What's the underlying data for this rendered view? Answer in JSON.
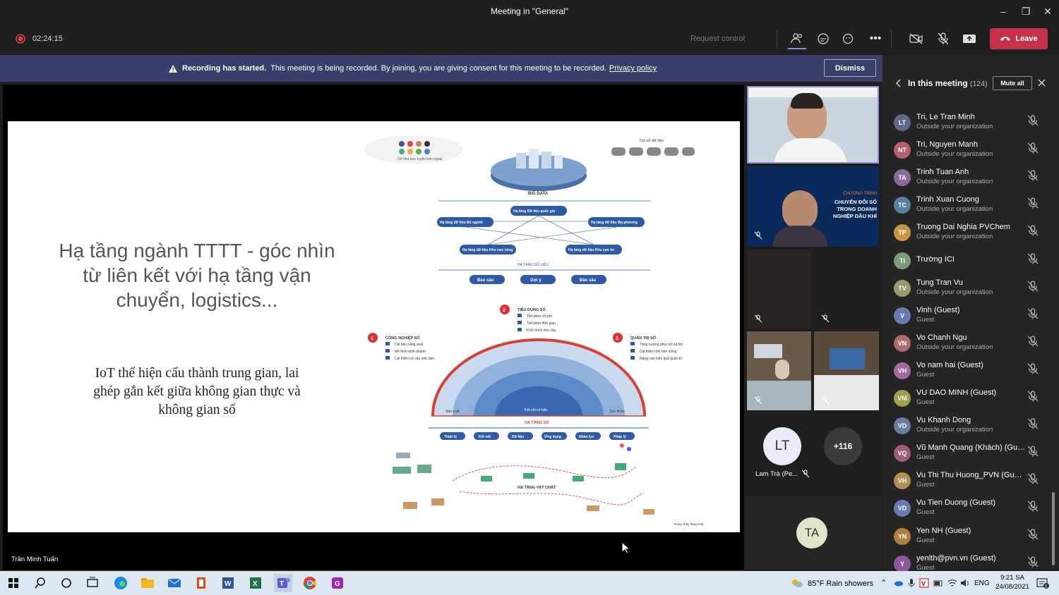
{
  "window": {
    "title": "Meeting in \"General\""
  },
  "toolbar": {
    "timer": "02:24:15",
    "request_control": "Request control",
    "leave_label": "Leave"
  },
  "banner": {
    "strong": "Recording has started.",
    "text": "This meeting is being recorded. By joining, you are giving consent for this meeting to be recorded.",
    "link": "Privacy policy",
    "dismiss": "Dismiss"
  },
  "slide": {
    "title": "Hạ tầng ngành TTTT - góc nhìn từ liên kết với hạ tầng vận chuyển, logistics...",
    "body": "IoT thể hiện cấu thành trung gian, lai ghép gắn kết giữa không gian thực và không gian số",
    "diagram": {
      "big_data": "BIG DATA",
      "source_left": "Dữ liệu trực tuyến bên ngoài",
      "source_right": "Cơ sở dữ liệu",
      "node_national": "Hạ tầng Dữ liệu quốc gia",
      "node_sector": "Hạ tầng dữ liệu Bộ ngành",
      "node_local": "Hạ tầng dữ liệu địa phương",
      "node_public": "Hạ tầng dữ liệu Khu vực công",
      "node_private": "Hạ tầng dữ liệu Khu vực tư",
      "data_layer": "HẠ TẦNG DỮ LIỆU",
      "btn1": "Báo cáo",
      "btn2": "Gợi ý",
      "btn3": "Đào sâu",
      "consumer_title": "TIÊU DÙNG SỐ",
      "consumer_items": [
        "Tiết kiệm chi phí",
        "Tiết kiệm thời gian",
        "Kích thích nhu cầu"
      ],
      "industry_title": "CÔNG NGHIỆP SỐ",
      "industry_items": [
        "Cải tiến năng suất",
        "Mô hình kinh doanh",
        "Cải thiện cơ cấu việc làm"
      ],
      "gov_title": "QUẢN TRỊ SỐ",
      "gov_items": [
        "Tăng cường phúc lợi xã hội",
        "Cải thiện tính bền vững",
        "Nâng cao hiệu quả quản trị"
      ],
      "arc_left": "Sản xuất",
      "arc_right": "Sức khỏe",
      "arc_inner": "Kết nối cơ bản",
      "infra_layer": "HẠ TẦNG SỐ",
      "chips": [
        "Thiết bị",
        "Kết nối",
        "Dữ liệu",
        "Ứng dụng",
        "Nhân lực",
        "Pháp lý"
      ],
      "physical": "HẠ TẦNG VẬT CHẤT",
      "flow_legend": "Dòng chảy hàng hóa"
    },
    "presenter": "Trần Minh Tuấn"
  },
  "tiles": {
    "lt_initials": "LT",
    "lt_name": "Lam Trà (Pe...",
    "more": "+116",
    "ta_initials": "TA",
    "video2_top": "CHƯƠNG TRÌNH",
    "video2_main": "CHUYỂN ĐỔI SỐ TRONG DOANH NGHIỆP DẦU KHÍ"
  },
  "panel": {
    "title": "In this meeting",
    "count": "(124)",
    "mute_all": "Mute all",
    "participants": [
      {
        "initials": "LT",
        "name": "Tri, Le Tran Minh",
        "sub": "Outside your organization",
        "color": "#5b6a8a"
      },
      {
        "initials": "NT",
        "name": "Tri, Nguyen Manh",
        "sub": "Outside your organization",
        "color": "#b5606b"
      },
      {
        "initials": "TA",
        "name": "Trinh Tuan Anh",
        "sub": "Outside your organization",
        "color": "#8a6a9a"
      },
      {
        "initials": "TC",
        "name": "Trinh Xuan Cuong",
        "sub": "Outside your organization",
        "color": "#5a80a0"
      },
      {
        "initials": "TP",
        "name": "Truong Dai Nghia PVChem",
        "sub": "Outside your organization",
        "color": "#c7954a"
      },
      {
        "initials": "TI",
        "name": "Trường ICI",
        "sub": "",
        "color": "#7a9a7a"
      },
      {
        "initials": "TV",
        "name": "Tung Tran Vu",
        "sub": "Outside your organization",
        "color": "#9a9a70"
      },
      {
        "initials": "V",
        "name": "Vinh (Guest)",
        "sub": "Guest",
        "color": "#6a7ab0"
      },
      {
        "initials": "VN",
        "name": "Vo Chanh Ngu",
        "sub": "Outside your organization",
        "color": "#b06a6a"
      },
      {
        "initials": "VH",
        "name": "Vo nam hai (Guest)",
        "sub": "Guest",
        "color": "#a06a9a"
      },
      {
        "initials": "VM",
        "name": "VU DAO MINH (Guest)",
        "sub": "Guest",
        "color": "#a0a050"
      },
      {
        "initials": "VD",
        "name": "Vu Khanh Dong",
        "sub": "Outside your organization",
        "color": "#6a7aa0"
      },
      {
        "initials": "VQ",
        "name": "Vũ Mạnh Quang (Khách) (Gue...",
        "sub": "Guest",
        "color": "#a05a7a"
      },
      {
        "initials": "VH",
        "name": "Vu Thi Thu Huong_PVN (Guest)",
        "sub": "Guest",
        "color": "#b09050"
      },
      {
        "initials": "VD",
        "name": "Vu Tien Duong (Guest)",
        "sub": "Guest",
        "color": "#6a7ab0"
      },
      {
        "initials": "YN",
        "name": "Yen NH (Guest)",
        "sub": "Guest",
        "color": "#b08040"
      },
      {
        "initials": "Y",
        "name": "yenlth@pvn.vn (Guest)",
        "sub": "Guest",
        "color": "#8a5a9a"
      }
    ]
  },
  "taskbar": {
    "weather": "85°F  Rain showers",
    "lang": "ENG",
    "time": "9:21 SA",
    "date": "24/08/2021"
  }
}
